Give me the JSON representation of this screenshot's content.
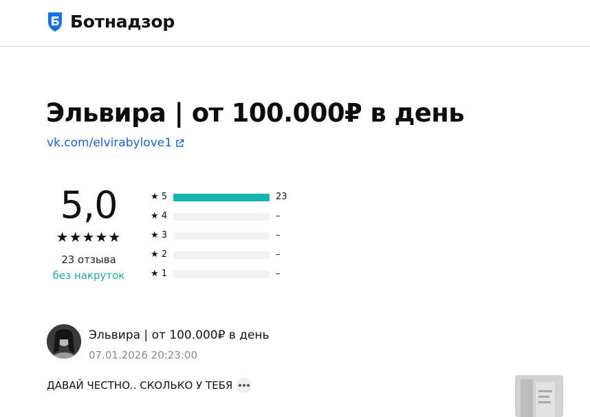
{
  "header": {
    "brand": "Ботнадзор",
    "brand_icon": "shield-icon",
    "brand_color": "#1a73e8"
  },
  "profile": {
    "title": "Эльвира | от 100.000₽ в день",
    "link_text": "vk.com/elvirabylove1",
    "link_icon": "external-link-icon"
  },
  "rating": {
    "score": "5,0",
    "stars": "★★★★★",
    "reviews_count": "23 отзыва",
    "no_fake_label": "без накруток",
    "accent_color": "#12b5a9",
    "distribution": [
      {
        "label": "★ 5",
        "count": "23",
        "fraction": 1.0
      },
      {
        "label": "★ 4",
        "count": "–",
        "fraction": 0
      },
      {
        "label": "★ 3",
        "count": "–",
        "fraction": 0
      },
      {
        "label": "★ 2",
        "count": "–",
        "fraction": 0
      },
      {
        "label": "★ 1",
        "count": "–",
        "fraction": 0
      }
    ]
  },
  "review": {
    "author": "Эльвира | от 100.000₽ в день",
    "date": "07.01.2026 20:23:00",
    "text": "ДАВАЙ ЧЕСТНО.. СКОЛЬКО У ТЕБЯ",
    "more_icon": "more-dots-icon"
  }
}
